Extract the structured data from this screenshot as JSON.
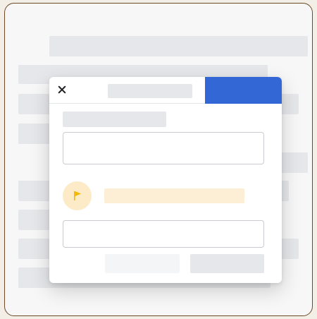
{
  "colors": {
    "outer_background": "#f4efe6",
    "frame_border": "#6b4a2a",
    "placeholder_gray": "#e6e7ea",
    "primary_blue": "#3367d6",
    "flag_badge_bg": "#fcebc6",
    "flag_yellow": "#f5b800",
    "notice_bar": "#fcefd6"
  },
  "dialog": {
    "close_icon": "close-icon",
    "flag_icon": "flag-icon"
  }
}
